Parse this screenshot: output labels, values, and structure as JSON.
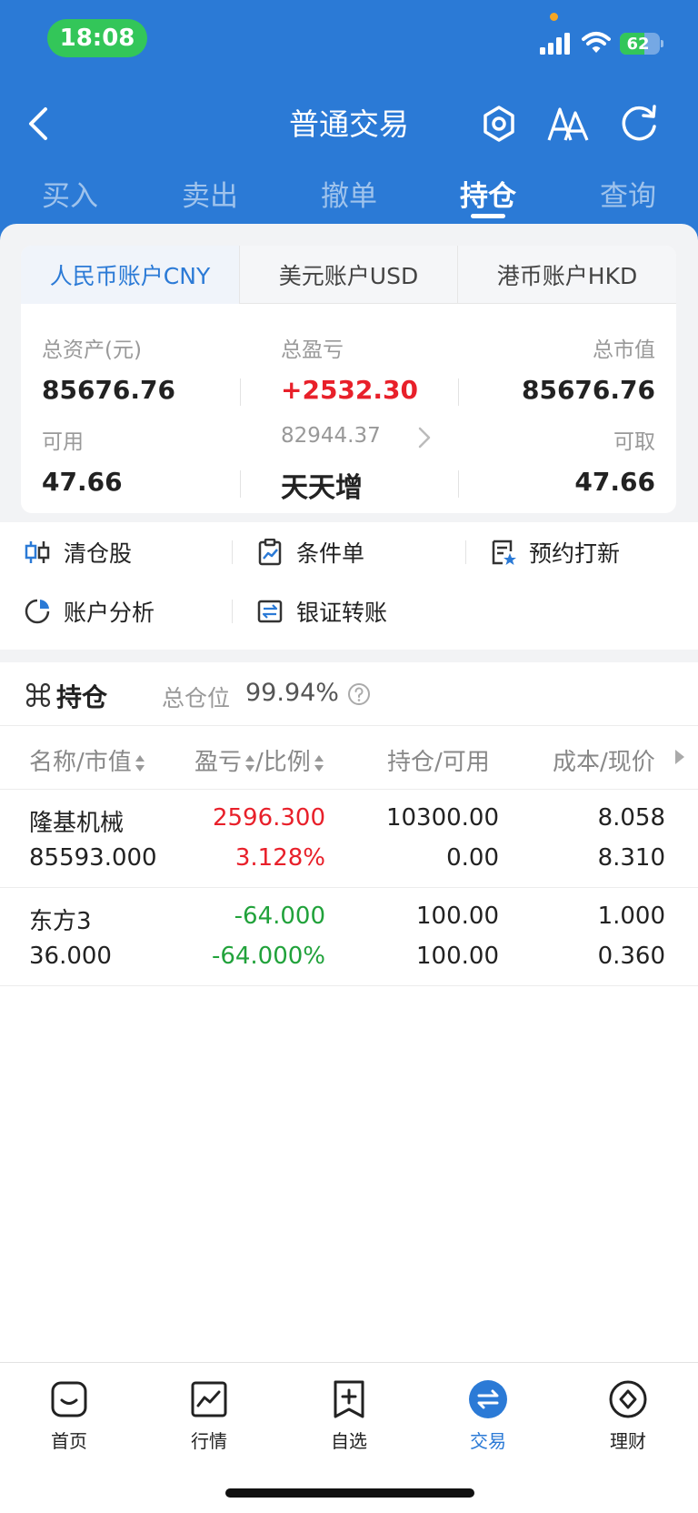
{
  "status_bar": {
    "time": "18:08",
    "battery": "62",
    "battery_level": 0.62
  },
  "nav": {
    "title": "普通交易"
  },
  "trade_tabs": [
    "买入",
    "卖出",
    "撤单",
    "持仓",
    "查询"
  ],
  "trade_tab_active": "持仓",
  "account_tabs": [
    "人民币账户CNY",
    "美元账户USD",
    "港币账户HKD"
  ],
  "account_tab_active": "人民币账户CNY",
  "summary": {
    "total_assets_label": "总资产(元)",
    "total_assets": "85676.76",
    "total_pl_label": "总盈亏",
    "total_pl": "+2532.30",
    "market_value_label": "总市值",
    "market_value": "85676.76",
    "available_label": "可用",
    "available": "47.66",
    "middle_amount": "82944.37",
    "middle_product": "天天增",
    "withdrawable_label": "可取",
    "withdrawable": "47.66"
  },
  "shortcuts": [
    "清仓股",
    "条件单",
    "预约打新",
    "账户分析",
    "银证转账"
  ],
  "holdings": {
    "title": "持仓",
    "position_label": "总仓位",
    "position_value": "99.94%",
    "columns": [
      "名称/市值",
      "盈亏",
      "/比例",
      "持仓/可用",
      "成本/现价"
    ],
    "rows": [
      {
        "name": "隆基机械",
        "market_value": "85593.000",
        "pl": "2596.300",
        "pl_ratio": "3.128%",
        "holding": "10300.00",
        "available": "0.00",
        "cost": "8.058",
        "price": "8.310",
        "trend": "up"
      },
      {
        "name": "东方3",
        "market_value": "36.000",
        "pl": "-64.000",
        "pl_ratio": "-64.000%",
        "holding": "100.00",
        "available": "100.00",
        "cost": "1.000",
        "price": "0.360",
        "trend": "down"
      }
    ]
  },
  "bottom_nav": [
    "首页",
    "行情",
    "自选",
    "交易",
    "理财"
  ],
  "bottom_nav_active": "交易",
  "colors": {
    "brand": "#2b7ad6",
    "up": "#e8202a",
    "down": "#21a23b",
    "status_green": "#33c659"
  }
}
